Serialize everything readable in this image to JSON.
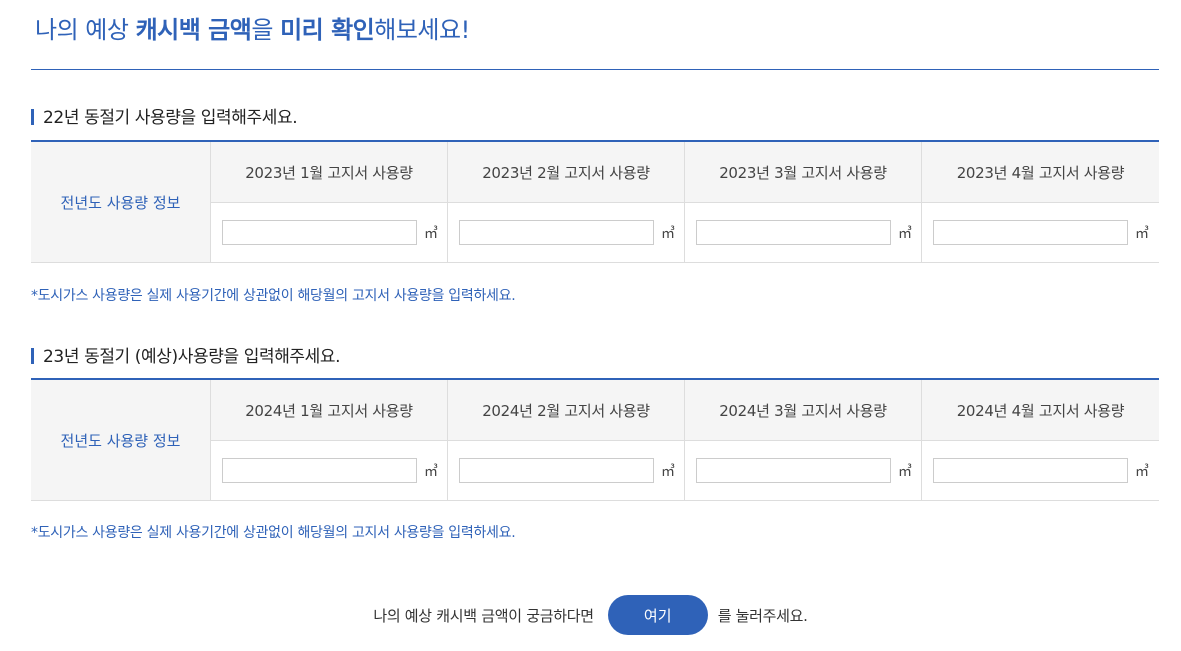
{
  "title": {
    "part1": "나의 예상 ",
    "emphasis1": "캐시백 금액",
    "part2": "을 ",
    "emphasis2": "미리 확인",
    "part3": "해보세요!"
  },
  "sections": [
    {
      "heading": "22년 동절기 사용량을 입력해주세요.",
      "row_header": "전년도 사용량 정보",
      "columns": [
        {
          "label": "2023년 1월 고지서 사용량",
          "value": "",
          "unit": "㎥"
        },
        {
          "label": "2023년 2월 고지서 사용량",
          "value": "",
          "unit": "㎥"
        },
        {
          "label": "2023년 3월 고지서 사용량",
          "value": "",
          "unit": "㎥"
        },
        {
          "label": "2023년 4월 고지서 사용량",
          "value": "",
          "unit": "㎥"
        }
      ],
      "note": "*도시가스 사용량은 실제 사용기간에 상관없이 해당월의 고지서 사용량을 입력하세요."
    },
    {
      "heading": "23년 동절기 (예상)사용량을 입력해주세요.",
      "row_header": "전년도 사용량 정보",
      "columns": [
        {
          "label": "2024년 1월 고지서 사용량",
          "value": "",
          "unit": "㎥"
        },
        {
          "label": "2024년 2월 고지서 사용량",
          "value": "",
          "unit": "㎥"
        },
        {
          "label": "2024년 3월 고지서 사용량",
          "value": "",
          "unit": "㎥"
        },
        {
          "label": "2024년 4월 고지서 사용량",
          "value": "",
          "unit": "㎥"
        }
      ],
      "note": "*도시가스 사용량은 실제 사용기간에 상관없이 해당월의 고지서 사용량을 입력하세요."
    }
  ],
  "cta": {
    "prefix": "나의 예상 캐시백 금액이 궁금하다면",
    "button_label": "여기",
    "suffix": "를 눌러주세요."
  },
  "colors": {
    "accent": "#2f62b8",
    "header_bg": "#f5f5f5",
    "border": "#dddddd"
  }
}
